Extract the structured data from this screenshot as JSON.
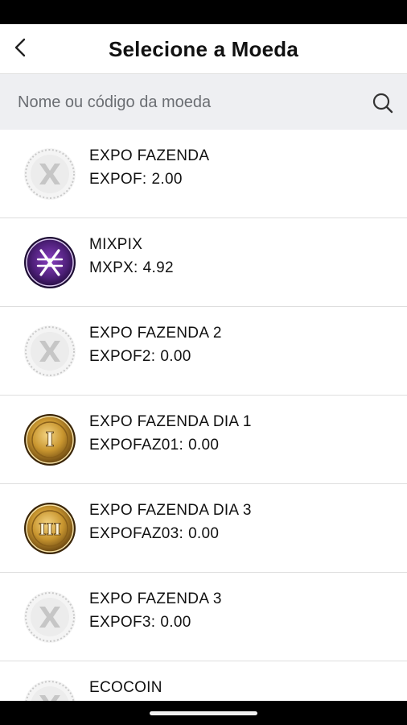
{
  "header": {
    "title": "Selecione a Moeda",
    "back_icon": "chevron-left-icon"
  },
  "search": {
    "placeholder": "Nome ou código da moeda",
    "value": "",
    "icon": "search-icon"
  },
  "coins": [
    {
      "name": "EXPO FAZENDA",
      "code": "EXPOF",
      "balance": "2.00",
      "icon": "expo-x-coin-icon"
    },
    {
      "name": "MIXPIX",
      "code": "MXPX",
      "balance": "4.92",
      "icon": "mixpix-coin-icon"
    },
    {
      "name": "EXPO FAZENDA 2",
      "code": "EXPOF2",
      "balance": "0.00",
      "icon": "expo-x-coin-icon"
    },
    {
      "name": "EXPO FAZENDA DIA 1",
      "code": "EXPOFAZ01",
      "balance": "0.00",
      "icon": "gold-roman-numeral-coin-icon",
      "numeral": "I"
    },
    {
      "name": "EXPO FAZENDA DIA 3",
      "code": "EXPOFAZ03",
      "balance": "0.00",
      "icon": "gold-roman-numeral-coin-icon",
      "numeral": "III"
    },
    {
      "name": "EXPO FAZENDA 3",
      "code": "EXPOF3",
      "balance": "0.00",
      "icon": "expo-x-coin-icon"
    },
    {
      "name": "ECOCOIN",
      "code": "",
      "balance": "",
      "icon": "expo-x-coin-icon"
    }
  ],
  "colors": {
    "search_bg": "#eeeff2",
    "divider": "#dedede",
    "mixpix_purple": "#5b2a86",
    "gold": "#c9962f"
  }
}
